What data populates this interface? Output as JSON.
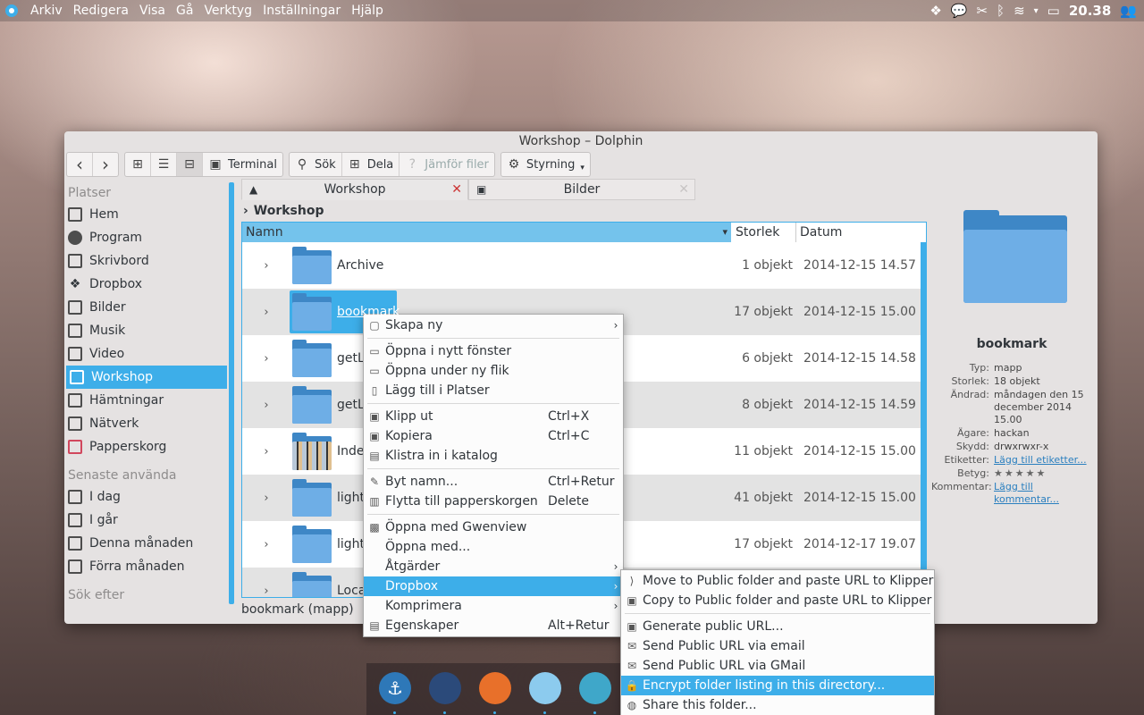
{
  "panel": {
    "menu": [
      "Arkiv",
      "Redigera",
      "Visa",
      "Gå",
      "Verktyg",
      "Inställningar",
      "Hjälp"
    ],
    "clock": "20.38",
    "tray_icons": [
      "dropbox-icon",
      "chat-icon",
      "clipboard-scissors-icon",
      "bluetooth-icon",
      "wifi-icon",
      "expand-arrow-icon",
      "battery-icon",
      "user-switch-icon"
    ]
  },
  "window": {
    "title": "Workshop – Dolphin"
  },
  "toolbar": {
    "back": "‹",
    "forward": "›",
    "terminal": "Terminal",
    "search": "Sök",
    "share": "Dela",
    "compare": "Jämför filer",
    "control": "Styrning"
  },
  "sidebar": {
    "places_header": "Platser",
    "places": [
      "Hem",
      "Program",
      "Skrivbord",
      "Dropbox",
      "Bilder",
      "Musik",
      "Video",
      "Workshop",
      "Hämtningar",
      "Nätverk",
      "Papperskorg"
    ],
    "recent_header": "Senaste använda",
    "recent": [
      "I dag",
      "I går",
      "Denna månaden",
      "Förra månaden"
    ],
    "search_header": "Sök efter"
  },
  "tabs": [
    {
      "label": "Workshop"
    },
    {
      "label": "Bilder"
    }
  ],
  "breadcrumb": {
    "arrow": "›",
    "current": "Workshop"
  },
  "fileview": {
    "headers": {
      "name": "Namn",
      "size": "Storlek",
      "date": "Datum"
    },
    "rows": [
      {
        "name": "Archive",
        "size": "1 objekt",
        "date": "2014-12-15 14.57"
      },
      {
        "name": "bookmark",
        "size": "17 objekt",
        "date": "2014-12-15 15.00"
      },
      {
        "name": "getL",
        "size": "6 objekt",
        "date": "2014-12-15 14.58"
      },
      {
        "name": "getL",
        "size": "8 objekt",
        "date": "2014-12-15 14.59"
      },
      {
        "name": "Inde",
        "size": "11 objekt",
        "date": "2014-12-15 15.00"
      },
      {
        "name": "light",
        "size": "41 objekt",
        "date": "2014-12-15 15.00"
      },
      {
        "name": "light",
        "size": "17 objekt",
        "date": "2014-12-17 19.07"
      },
      {
        "name": "Loca",
        "size": "",
        "date": ""
      }
    ]
  },
  "statusbar": "bookmark (mapp)",
  "info": {
    "title": "bookmark",
    "rows": [
      {
        "k": "Typ:",
        "v": "mapp"
      },
      {
        "k": "Storlek:",
        "v": "18 objekt"
      },
      {
        "k": "Ändrad:",
        "v": "måndagen den 15 december 2014 15.00"
      },
      {
        "k": "Ägare:",
        "v": "hackan"
      },
      {
        "k": "Skydd:",
        "v": "drwxrwxr-x"
      },
      {
        "k": "Etiketter:",
        "v": "Lägg till etiketter..."
      },
      {
        "k": "Betyg:",
        "v": "★★★★★"
      },
      {
        "k": "Kommentar:",
        "v": "Lägg till kommentar..."
      }
    ]
  },
  "context_menu": {
    "items": [
      {
        "label": "Skapa ny",
        "shortcut": "",
        "arrow": "›"
      },
      {
        "label": "Öppna i nytt fönster",
        "shortcut": "",
        "arrow": ""
      },
      {
        "label": "Öppna under ny flik",
        "shortcut": "",
        "arrow": ""
      },
      {
        "label": "Lägg till i Platser",
        "shortcut": "",
        "arrow": ""
      },
      {
        "label": "Klipp ut",
        "shortcut": "Ctrl+X",
        "arrow": ""
      },
      {
        "label": "Kopiera",
        "shortcut": "Ctrl+C",
        "arrow": ""
      },
      {
        "label": "Klistra in i katalog",
        "shortcut": "",
        "arrow": ""
      },
      {
        "label": "Byt namn...",
        "shortcut": "Ctrl+Retur",
        "arrow": ""
      },
      {
        "label": "Flytta till papperskorgen",
        "shortcut": "Delete",
        "arrow": ""
      },
      {
        "label": "Öppna med Gwenview",
        "shortcut": "",
        "arrow": ""
      },
      {
        "label": "Öppna med...",
        "shortcut": "",
        "arrow": ""
      },
      {
        "label": "Åtgärder",
        "shortcut": "",
        "arrow": "›"
      },
      {
        "label": "Dropbox",
        "shortcut": "",
        "arrow": "›"
      },
      {
        "label": "Komprimera",
        "shortcut": "",
        "arrow": "›"
      },
      {
        "label": "Egenskaper",
        "shortcut": "Alt+Retur",
        "arrow": ""
      }
    ]
  },
  "dropbox_submenu": {
    "items": [
      {
        "label": "Move to Public folder and paste URL to Klipper"
      },
      {
        "label": "Copy to Public folder and paste URL to Klipper"
      },
      {
        "label": "Generate public URL..."
      },
      {
        "label": "Send Public URL via email"
      },
      {
        "label": "Send Public URL via GMail"
      },
      {
        "label": "Encrypt folder listing in this directory..."
      },
      {
        "label": "Share this folder..."
      }
    ]
  },
  "colors": {
    "accent": "#3daee9",
    "folder_front": "#6eaee6",
    "folder_back": "#3e87c6"
  }
}
